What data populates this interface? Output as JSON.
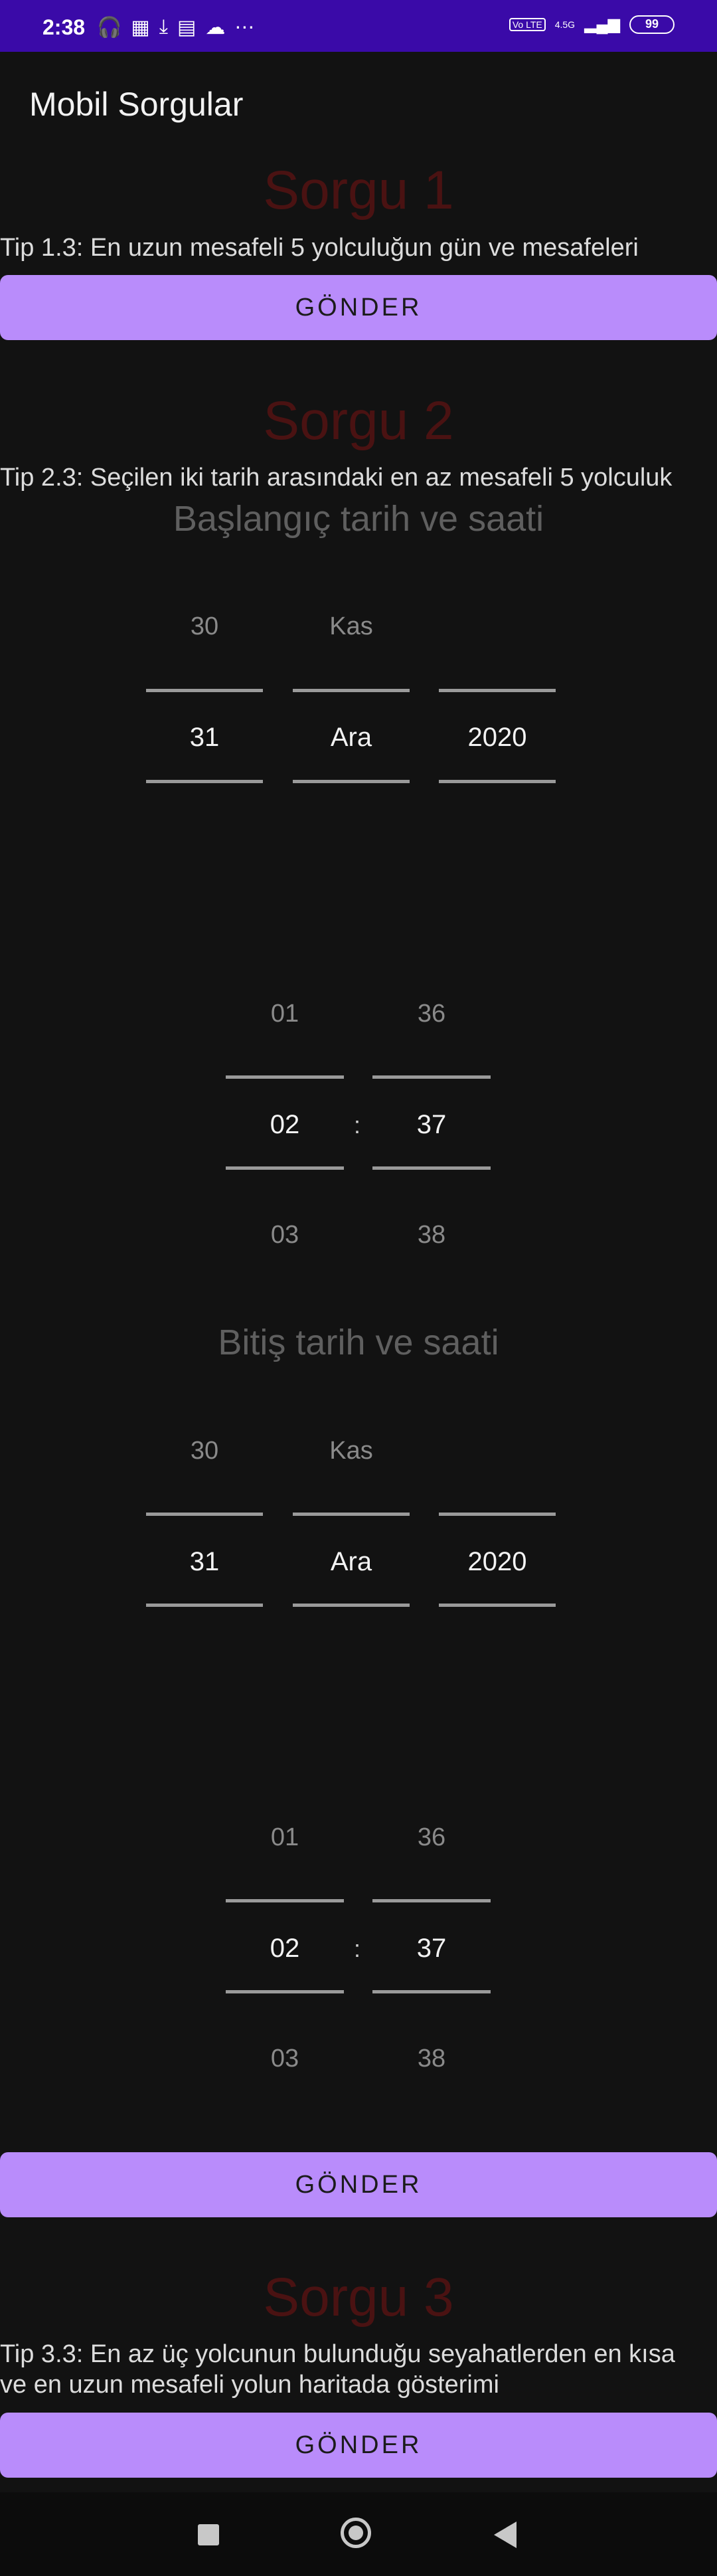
{
  "status": {
    "time": "2:38",
    "icons": [
      "headphones-icon",
      "apps-icon",
      "download-icon",
      "news-icon",
      "cloud-icon",
      "more-icon"
    ],
    "volte": "Vo LTE",
    "network": "4.5G",
    "battery": "99"
  },
  "app": {
    "title": "Mobil Sorgular"
  },
  "sorgu1": {
    "heading": "Sorgu 1",
    "description": "Tip 1.3: En uzun mesafeli 5 yolculuğun gün ve mesafeleri",
    "button": "GÖNDER"
  },
  "sorgu2": {
    "heading": "Sorgu 2",
    "description": "Tip 2.3: Seçilen iki tarih arasındaki en az mesafeli 5 yolculuk",
    "start": {
      "label": "Başlangıç tarih ve saati",
      "date": {
        "prev_day": "30",
        "prev_month": "Kas",
        "prev_year": "",
        "day": "31",
        "month": "Ara",
        "year": "2020"
      },
      "time": {
        "prev_hour": "01",
        "prev_minute": "36",
        "hour": "02",
        "minute": "37",
        "next_hour": "03",
        "next_minute": "38",
        "separator": ":"
      }
    },
    "end": {
      "label": "Bitiş tarih ve saati",
      "date": {
        "prev_day": "30",
        "prev_month": "Kas",
        "prev_year": "",
        "day": "31",
        "month": "Ara",
        "year": "2020"
      },
      "time": {
        "prev_hour": "01",
        "prev_minute": "36",
        "hour": "02",
        "minute": "37",
        "next_hour": "03",
        "next_minute": "38",
        "separator": ":"
      }
    },
    "button": "GÖNDER"
  },
  "sorgu3": {
    "heading": "Sorgu 3",
    "description_line1": "Tip 3.3: En az üç yolcunun bulunduğu seyahatlerden en kısa",
    "description_line2": "ve en uzun mesafeli yolun haritada gösterimi",
    "button": "GÖNDER"
  },
  "nav": {
    "icons": [
      "recents-square-icon",
      "home-circle-icon",
      "back-triangle-icon"
    ]
  }
}
